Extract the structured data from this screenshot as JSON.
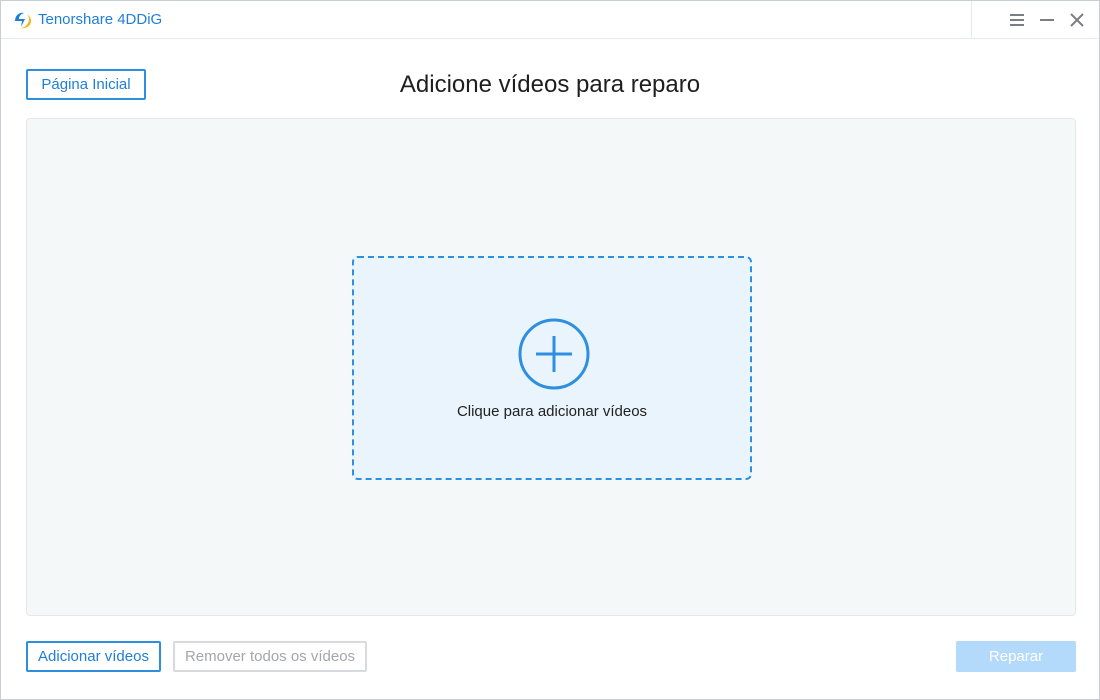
{
  "window": {
    "app_title": "Tenorshare 4DDiG",
    "logo_icon": "tenorshare-logo-icon",
    "controls": [
      "menu-icon",
      "minimize-icon",
      "close-icon"
    ]
  },
  "header": {
    "home_button": "Página Inicial",
    "page_title": "Adicione vídeos para reparo"
  },
  "dropzone": {
    "icon": "plus-circle-icon",
    "label": "Clique para adicionar vídeos"
  },
  "footer": {
    "add_button": "Adicionar vídeos",
    "remove_all_button": "Remover todos os vídeos",
    "repair_button": "Reparar"
  },
  "colors": {
    "accent": "#2e8fe0",
    "accent_text": "#1f7fd6",
    "panel_bg": "#f4f8f9",
    "dropzone_bg": "#eaf4fc",
    "disabled_text": "#a4a6a9",
    "repair_disabled_bg": "#b3dafa"
  }
}
